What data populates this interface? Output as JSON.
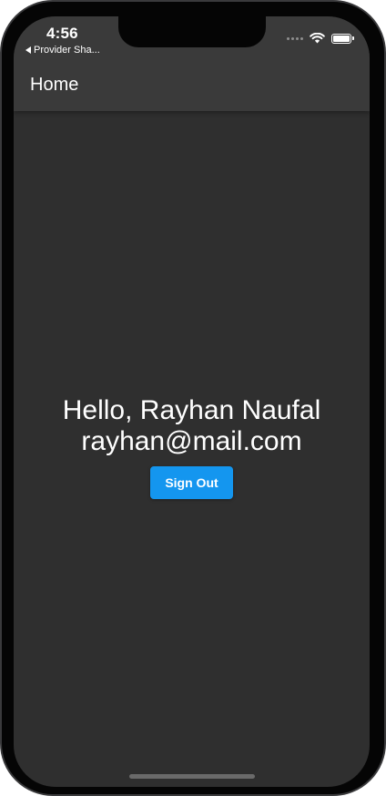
{
  "status_bar": {
    "time": "4:56",
    "back_app_label": "Provider Sha...",
    "signal_icon": "cellular-dots-icon",
    "wifi_icon": "wifi-icon",
    "battery_icon": "battery-icon",
    "battery_level": 1.0
  },
  "app_bar": {
    "title": "Home",
    "background_color": "#3a3a3a"
  },
  "main": {
    "greeting": "Hello, Rayhan Naufal",
    "email": "rayhan@mail.com",
    "sign_out_label": "Sign Out",
    "button_color": "#1496ef",
    "background_color": "#2f2f2f"
  }
}
